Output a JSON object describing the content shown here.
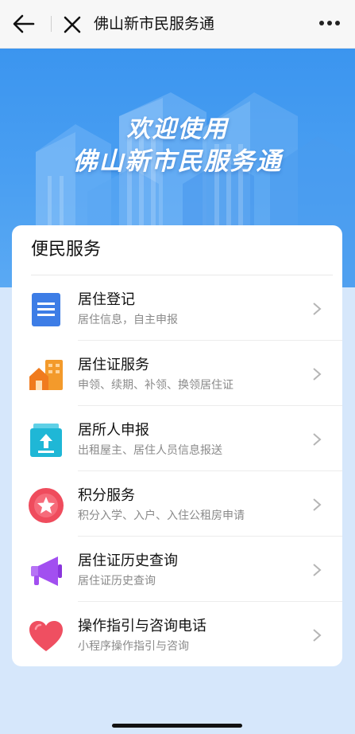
{
  "navbar": {
    "title": "佛山新市民服务通"
  },
  "hero": {
    "line1": "欢迎使用",
    "line2": "佛山新市民服务通"
  },
  "services": {
    "heading": "便民服务",
    "items": [
      {
        "title": "居住登记",
        "subtitle": "居住信息，自主申报",
        "icon": "document-icon",
        "color": "#3d7de6"
      },
      {
        "title": "居住证服务",
        "subtitle": "申领、续期、补领、换领居住证",
        "icon": "house-icon",
        "color": "#f39a2b"
      },
      {
        "title": "居所人申报",
        "subtitle": "出租屋主、居住人员信息报送",
        "icon": "upload-box-icon",
        "color": "#1fb7d6"
      },
      {
        "title": "积分服务",
        "subtitle": "积分入学、入户、入住公租房申请",
        "icon": "star-badge-icon",
        "color": "#ef4c5d"
      },
      {
        "title": "居住证历史查询",
        "subtitle": "居住证历史查询",
        "icon": "megaphone-icon",
        "color": "#a24ff0"
      },
      {
        "title": "操作指引与咨询电话",
        "subtitle": "小程序操作指引与咨询",
        "icon": "heart-icon",
        "color": "#ef4f61"
      }
    ]
  }
}
